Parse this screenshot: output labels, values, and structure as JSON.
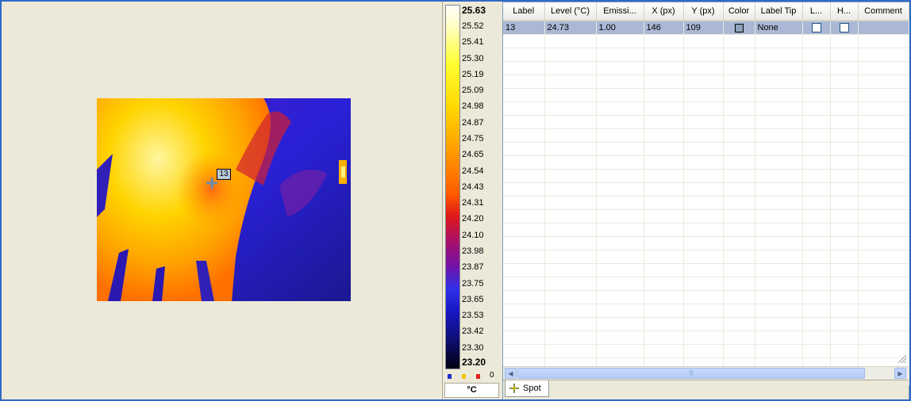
{
  "image_view": {
    "spot_label": "13"
  },
  "scale": {
    "max": "25.63",
    "ticks": [
      "25.52",
      "25.41",
      "25.30",
      "25.19",
      "25.09",
      "24.98",
      "24.87",
      "24.75",
      "24.65",
      "24.54",
      "24.43",
      "24.31",
      "24.20",
      "24.10",
      "23.98",
      "23.87",
      "23.75",
      "23.65",
      "23.53",
      "23.42",
      "23.30"
    ],
    "min": "23.20",
    "legend_count": "0",
    "legend_colors": [
      "#2030c8",
      "#f0c800",
      "#e02020"
    ],
    "unit": "°C"
  },
  "table": {
    "columns": [
      "Label",
      "Level (°C)",
      "Emissi...",
      "X (px)",
      "Y (px)",
      "Color",
      "Label Tip",
      "L...",
      "H...",
      "Comment"
    ],
    "rows": [
      {
        "label": "13",
        "level": "24.73",
        "emissivity": "1.00",
        "x": "146",
        "y": "109",
        "color": "#8fa4bc",
        "label_tip": "None",
        "comment": ""
      }
    ]
  },
  "tabs": [
    {
      "label": "Spot",
      "icon": "crosshair-icon"
    }
  ]
}
